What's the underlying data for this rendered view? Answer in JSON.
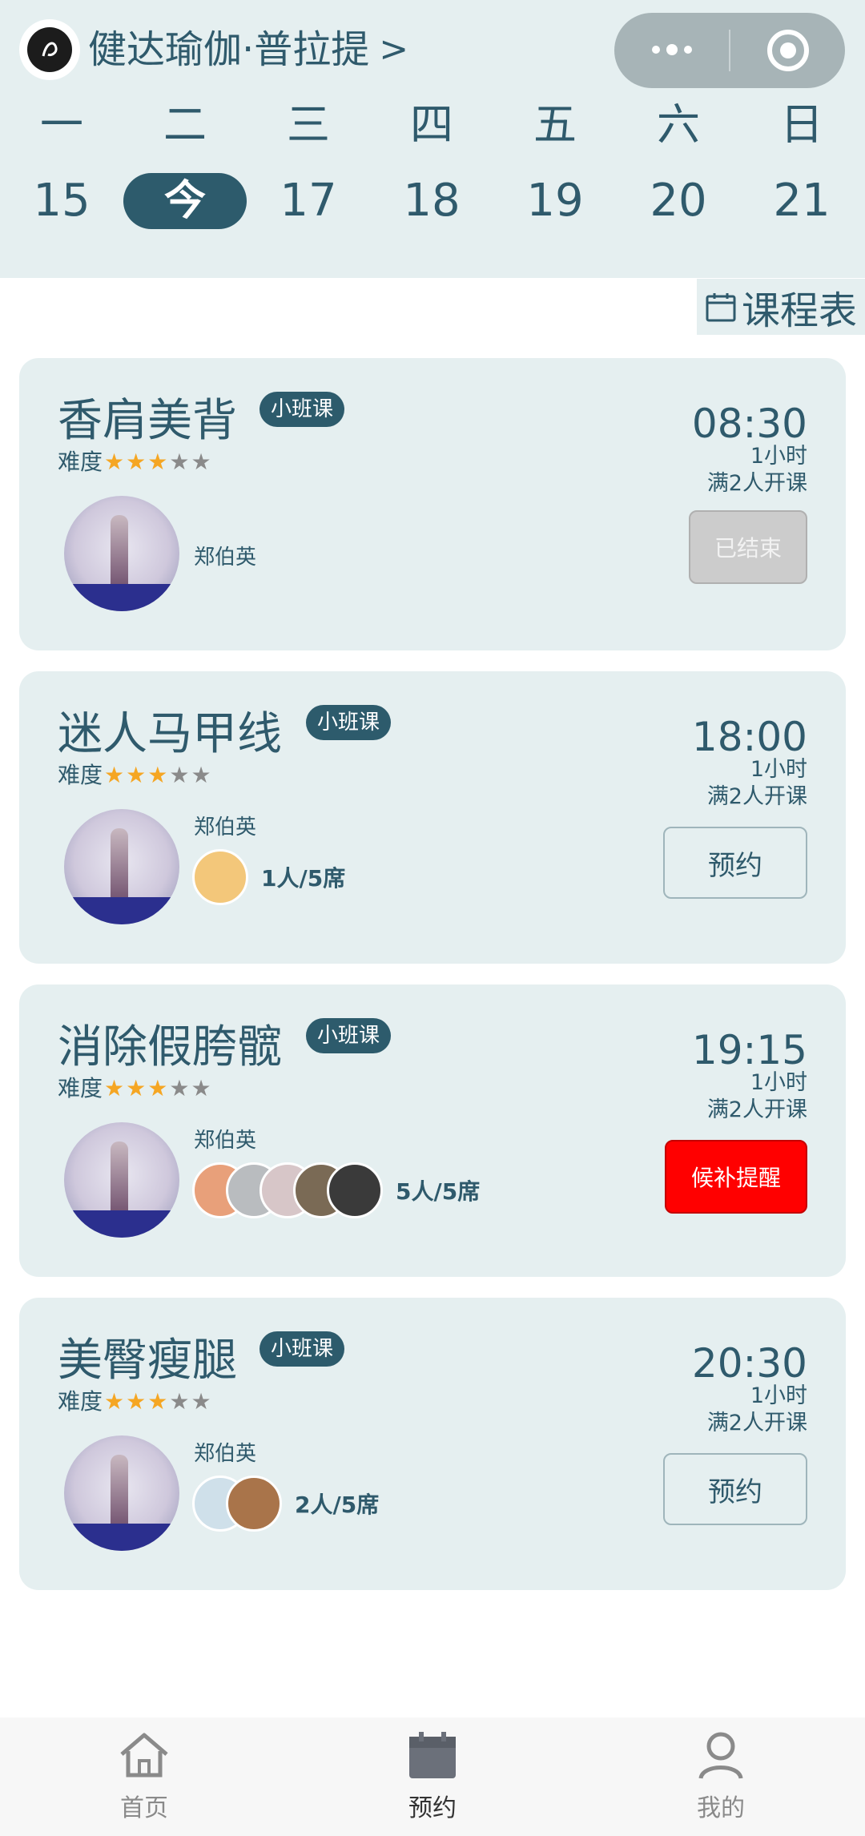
{
  "header": {
    "shop_name": "健达瑜伽·普拉提",
    "chevron": ">",
    "logo_text": "健达瑜伽"
  },
  "calendar": {
    "weekdays": [
      "一",
      "二",
      "三",
      "四",
      "五",
      "六",
      "日"
    ],
    "dates": [
      "15",
      "今",
      "17",
      "18",
      "19",
      "20",
      "21"
    ],
    "selected_index": 1
  },
  "schedule_button": {
    "label": "课程表"
  },
  "courses": [
    {
      "name": "香肩美背",
      "badge": "小班课",
      "difficulty_label": "难度",
      "difficulty": 3,
      "difficulty_max": 5,
      "teacher": "郑伯英",
      "time": "08:30",
      "duration": "1小时",
      "min_people": "满2人开课",
      "action": "已结束",
      "action_type": "ended",
      "members": [],
      "count": ""
    },
    {
      "name": "迷人马甲线",
      "badge": "小班课",
      "difficulty_label": "难度",
      "difficulty": 3,
      "difficulty_max": 5,
      "teacher": "郑伯英",
      "time": "18:00",
      "duration": "1小时",
      "min_people": "满2人开课",
      "action": "预约",
      "action_type": "book",
      "members": [
        "#f3c77a"
      ],
      "count": "1人/5席"
    },
    {
      "name": "消除假胯髋",
      "badge": "小班课",
      "difficulty_label": "难度",
      "difficulty": 3,
      "difficulty_max": 5,
      "teacher": "郑伯英",
      "time": "19:15",
      "duration": "1小时",
      "min_people": "满2人开课",
      "action": "候补提醒",
      "action_type": "wait",
      "members": [
        "#e8a07a",
        "#b9bcbf",
        "#d7c6c8",
        "#7a6a55",
        "#3a3a3a"
      ],
      "count": "5人/5席"
    },
    {
      "name": "美臀瘦腿",
      "badge": "小班课",
      "difficulty_label": "难度",
      "difficulty": 3,
      "difficulty_max": 5,
      "teacher": "郑伯英",
      "time": "20:30",
      "duration": "1小时",
      "min_people": "满2人开课",
      "action": "预约",
      "action_type": "book",
      "members": [
        "#cfe0ea",
        "#a9744a"
      ],
      "count": "2人/5席"
    }
  ],
  "tabbar": {
    "items": [
      {
        "label": "首页",
        "icon": "home-icon",
        "active": false
      },
      {
        "label": "预约",
        "icon": "calendar-icon",
        "active": true
      },
      {
        "label": "我的",
        "icon": "user-icon",
        "active": false
      }
    ]
  },
  "colors": {
    "primary": "#2d5b6c",
    "panel": "#e5eff0",
    "star_on": "#f5a623",
    "star_off": "#8a8a8a",
    "danger": "#ff0000"
  }
}
